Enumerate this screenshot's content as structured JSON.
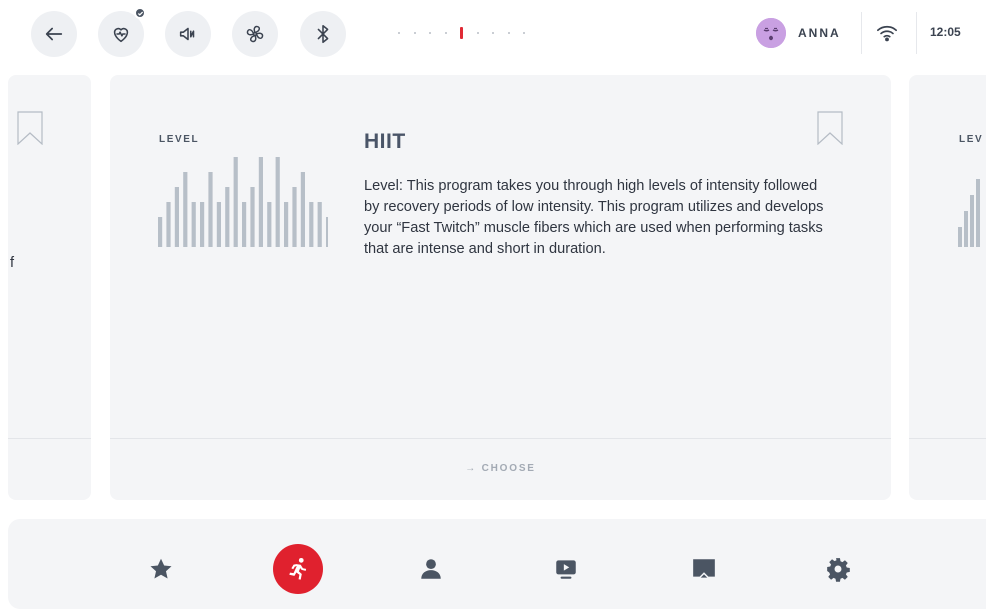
{
  "header": {
    "icons": [
      "back-arrow-icon",
      "heart-rate-icon",
      "sound-icon",
      "fan-icon",
      "bluetooth-icon"
    ],
    "pager": {
      "total": 9,
      "active_index": 4
    },
    "user": {
      "name": "ANNA",
      "avatar": "sleepy-face-avatar"
    },
    "clock": "12:05"
  },
  "cards": {
    "left": {
      "partial_text": "f"
    },
    "main": {
      "level_label": "LEVEL",
      "level_bars": [
        2,
        3,
        4,
        5,
        3,
        3,
        5,
        3,
        4,
        6,
        3,
        4,
        6,
        3,
        6,
        3,
        4,
        5,
        3,
        3,
        2
      ],
      "title": "HIIT",
      "description": "Level: This program takes you through high levels of intensity followed by recovery periods of low intensity. This program utilizes and develops your “Fast Twitch” muscle fibers which are used when performing tasks that are intense and short in duration.",
      "choose_label": "CHOOSE"
    },
    "right": {
      "level_label": "LEV"
    }
  },
  "bottom_nav": {
    "items": [
      "star-icon",
      "runner-icon",
      "user-icon",
      "video-play-icon",
      "screen-cast-icon",
      "gear-icon"
    ],
    "active_index": 1
  },
  "colors": {
    "accent": "#e0212e",
    "card_bg": "#f4f5f7",
    "bar": "#b7bfc8"
  }
}
